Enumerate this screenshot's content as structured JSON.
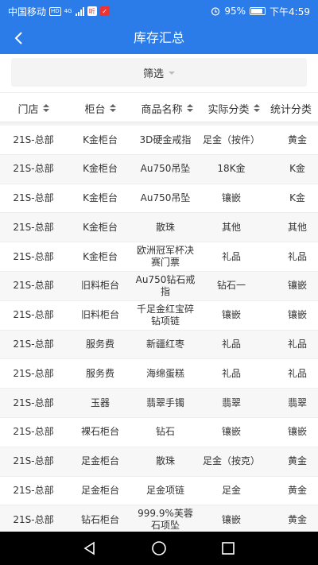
{
  "statusbar": {
    "carrier": "中国移动",
    "hd_badge": "HD",
    "net": "4G",
    "battery_pct": "95%",
    "time": "下午4:59"
  },
  "header": {
    "title": "库存汇总"
  },
  "filter": {
    "label": "筛选"
  },
  "table": {
    "columns": [
      "门店",
      "柜台",
      "商品名称",
      "实际分类",
      "统计分类"
    ],
    "rows": [
      [
        "21S-总部",
        "K金柜台",
        "3D硬金戒指",
        "足金（按件）",
        "黄金"
      ],
      [
        "21S-总部",
        "K金柜台",
        "Au750吊坠",
        "18K金",
        "K金"
      ],
      [
        "21S-总部",
        "K金柜台",
        "Au750吊坠",
        "镶嵌",
        "K金"
      ],
      [
        "21S-总部",
        "K金柜台",
        "散珠",
        "其他",
        "其他"
      ],
      [
        "21S-总部",
        "K金柜台",
        "欧洲冠军杯决赛门票",
        "礼品",
        "礼品"
      ],
      [
        "21S-总部",
        "旧料柜台",
        "Au750钻石戒指",
        "钻石一",
        "镶嵌"
      ],
      [
        "21S-总部",
        "旧料柜台",
        "千足金红宝碎钻项链",
        "镶嵌",
        "镶嵌"
      ],
      [
        "21S-总部",
        "服务费",
        "新疆红枣",
        "礼品",
        "礼品"
      ],
      [
        "21S-总部",
        "服务费",
        "海绵蛋糕",
        "礼品",
        "礼品"
      ],
      [
        "21S-总部",
        "玉器",
        "翡翠手镯",
        "翡翠",
        "翡翠"
      ],
      [
        "21S-总部",
        "裸石柜台",
        "钻石",
        "镶嵌",
        "镶嵌"
      ],
      [
        "21S-总部",
        "足金柜台",
        "散珠",
        "足金（按克）",
        "黄金"
      ],
      [
        "21S-总部",
        "足金柜台",
        "足金项链",
        "足金",
        "黄金"
      ],
      [
        "21S-总部",
        "钻石柜台",
        "999.9%芙蓉石项坠",
        "镶嵌",
        "黄金"
      ]
    ]
  }
}
